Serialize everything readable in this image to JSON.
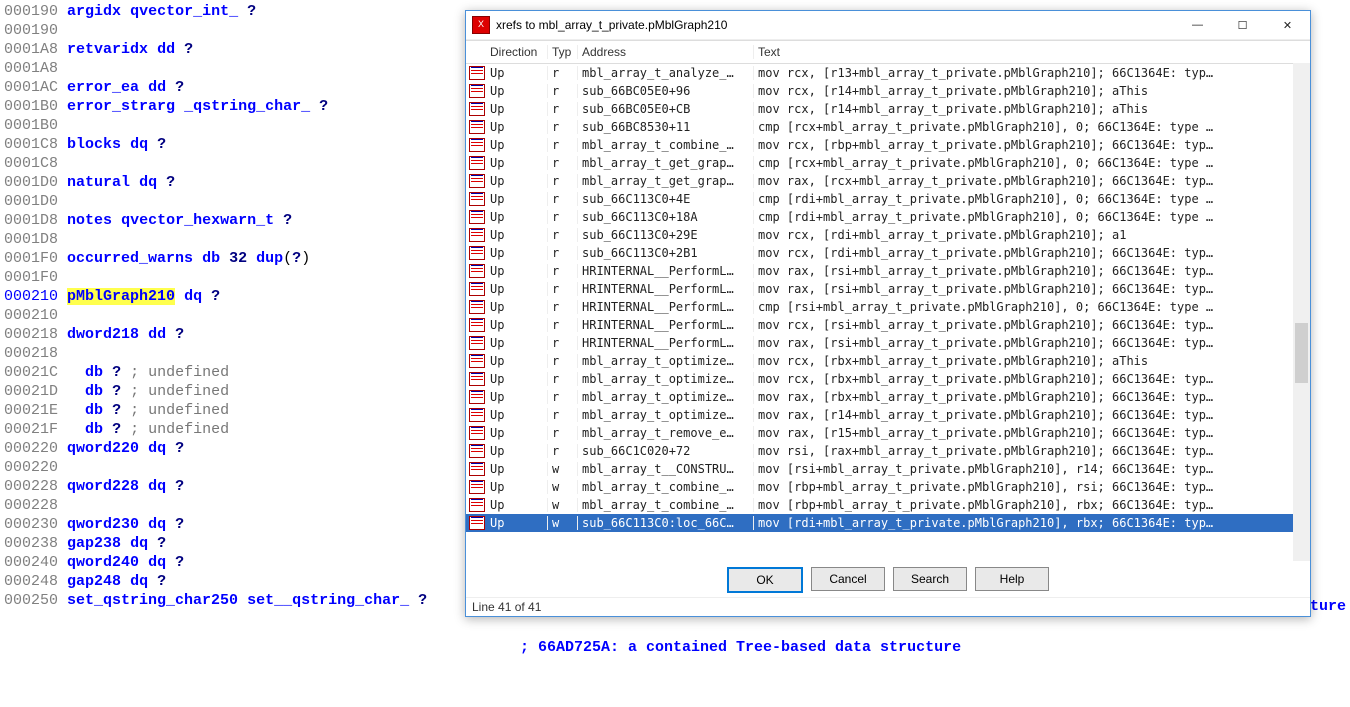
{
  "listing": [
    {
      "addr": "000190",
      "cls": "addr",
      "parts": [
        {
          "t": "argidx",
          "c": "name"
        },
        {
          "t": " "
        },
        {
          "t": "qvector_int_",
          "c": "kw"
        },
        {
          "t": " "
        },
        {
          "t": "?",
          "c": "val"
        }
      ]
    },
    {
      "addr": "000190",
      "cls": "addr"
    },
    {
      "addr": "0001A8",
      "cls": "addr",
      "parts": [
        {
          "t": "retvaridx",
          "c": "name"
        },
        {
          "t": " "
        },
        {
          "t": "dd",
          "c": "kw"
        },
        {
          "t": " "
        },
        {
          "t": "?",
          "c": "val"
        }
      ]
    },
    {
      "addr": "0001A8",
      "cls": "addr"
    },
    {
      "addr": "0001AC",
      "cls": "addr",
      "parts": [
        {
          "t": "error_ea",
          "c": "name"
        },
        {
          "t": " "
        },
        {
          "t": "dd",
          "c": "kw"
        },
        {
          "t": " "
        },
        {
          "t": "?",
          "c": "val"
        }
      ]
    },
    {
      "addr": "0001B0",
      "cls": "addr",
      "parts": [
        {
          "t": "error_strarg",
          "c": "name"
        },
        {
          "t": " "
        },
        {
          "t": "_qstring_char_",
          "c": "kw"
        },
        {
          "t": " "
        },
        {
          "t": "?",
          "c": "val"
        }
      ]
    },
    {
      "addr": "0001B0",
      "cls": "addr"
    },
    {
      "addr": "0001C8",
      "cls": "addr",
      "parts": [
        {
          "t": "blocks",
          "c": "name"
        },
        {
          "t": " "
        },
        {
          "t": "dq",
          "c": "kw"
        },
        {
          "t": " "
        },
        {
          "t": "?",
          "c": "val"
        }
      ]
    },
    {
      "addr": "0001C8",
      "cls": "addr"
    },
    {
      "addr": "0001D0",
      "cls": "addr",
      "parts": [
        {
          "t": "natural",
          "c": "name"
        },
        {
          "t": " "
        },
        {
          "t": "dq",
          "c": "kw"
        },
        {
          "t": " "
        },
        {
          "t": "?",
          "c": "val"
        }
      ]
    },
    {
      "addr": "0001D0",
      "cls": "addr"
    },
    {
      "addr": "0001D8",
      "cls": "addr",
      "parts": [
        {
          "t": "notes",
          "c": "name"
        },
        {
          "t": " "
        },
        {
          "t": "qvector_hexwarn_t",
          "c": "kw"
        },
        {
          "t": " "
        },
        {
          "t": "?",
          "c": "val"
        }
      ]
    },
    {
      "addr": "0001D8",
      "cls": "addr"
    },
    {
      "addr": "0001F0",
      "cls": "addr",
      "parts": [
        {
          "t": "occurred_warns",
          "c": "name"
        },
        {
          "t": " "
        },
        {
          "t": "db",
          "c": "kw"
        },
        {
          "t": " "
        },
        {
          "t": "32",
          "c": "val"
        },
        {
          "t": " "
        },
        {
          "t": "dup",
          "c": "kw"
        },
        {
          "t": "("
        },
        {
          "t": "?",
          "c": "val"
        },
        {
          "t": ")"
        }
      ]
    },
    {
      "addr": "0001F0",
      "cls": "addr"
    },
    {
      "addr": "000210",
      "cls": "addr-blue",
      "parts": [
        {
          "t": "pMblGraph210",
          "c": "name highlight"
        },
        {
          "t": " "
        },
        {
          "t": "dq",
          "c": "kw"
        },
        {
          "t": " "
        },
        {
          "t": "?",
          "c": "val"
        }
      ]
    },
    {
      "addr": "000210",
      "cls": "addr"
    },
    {
      "addr": "000218",
      "cls": "addr",
      "parts": [
        {
          "t": "dword218",
          "c": "name"
        },
        {
          "t": " "
        },
        {
          "t": "dd",
          "c": "kw"
        },
        {
          "t": " "
        },
        {
          "t": "?",
          "c": "val"
        }
      ]
    },
    {
      "addr": "000218",
      "cls": "addr"
    },
    {
      "addr": "00021C",
      "cls": "addr",
      "indent": 2,
      "parts": [
        {
          "t": "db",
          "c": "kw"
        },
        {
          "t": " "
        },
        {
          "t": "?",
          "c": "val"
        },
        {
          "t": " ; undefined",
          "c": "comment"
        }
      ]
    },
    {
      "addr": "00021D",
      "cls": "addr",
      "indent": 2,
      "parts": [
        {
          "t": "db",
          "c": "kw"
        },
        {
          "t": " "
        },
        {
          "t": "?",
          "c": "val"
        },
        {
          "t": " ; undefined",
          "c": "comment"
        }
      ]
    },
    {
      "addr": "00021E",
      "cls": "addr",
      "indent": 2,
      "parts": [
        {
          "t": "db",
          "c": "kw"
        },
        {
          "t": " "
        },
        {
          "t": "?",
          "c": "val"
        },
        {
          "t": " ; undefined",
          "c": "comment"
        }
      ]
    },
    {
      "addr": "00021F",
      "cls": "addr",
      "indent": 2,
      "parts": [
        {
          "t": "db",
          "c": "kw"
        },
        {
          "t": " "
        },
        {
          "t": "?",
          "c": "val"
        },
        {
          "t": " ; undefined",
          "c": "comment"
        }
      ]
    },
    {
      "addr": "000220",
      "cls": "addr",
      "parts": [
        {
          "t": "qword220",
          "c": "name"
        },
        {
          "t": " "
        },
        {
          "t": "dq",
          "c": "kw"
        },
        {
          "t": " "
        },
        {
          "t": "?",
          "c": "val"
        }
      ]
    },
    {
      "addr": "000220",
      "cls": "addr"
    },
    {
      "addr": "000228",
      "cls": "addr",
      "parts": [
        {
          "t": "qword228",
          "c": "name"
        },
        {
          "t": " "
        },
        {
          "t": "dq",
          "c": "kw"
        },
        {
          "t": " "
        },
        {
          "t": "?",
          "c": "val"
        }
      ]
    },
    {
      "addr": "000228",
      "cls": "addr"
    },
    {
      "addr": "000230",
      "cls": "addr",
      "parts": [
        {
          "t": "qword230",
          "c": "name"
        },
        {
          "t": " "
        },
        {
          "t": "dq",
          "c": "kw"
        },
        {
          "t": " "
        },
        {
          "t": "?",
          "c": "val"
        }
      ]
    },
    {
      "addr": "000238",
      "cls": "addr",
      "parts": [
        {
          "t": "gap238",
          "c": "name"
        },
        {
          "t": " "
        },
        {
          "t": "dq",
          "c": "kw"
        },
        {
          "t": " "
        },
        {
          "t": "?",
          "c": "val"
        }
      ]
    },
    {
      "addr": "000240",
      "cls": "addr",
      "parts": [
        {
          "t": "qword240",
          "c": "name"
        },
        {
          "t": " "
        },
        {
          "t": "dq",
          "c": "kw"
        },
        {
          "t": " "
        },
        {
          "t": "?",
          "c": "val"
        }
      ]
    },
    {
      "addr": "000248",
      "cls": "addr",
      "parts": [
        {
          "t": "gap248",
          "c": "name"
        },
        {
          "t": " "
        },
        {
          "t": "dq",
          "c": "kw"
        },
        {
          "t": " "
        },
        {
          "t": "?",
          "c": "val"
        }
      ]
    },
    {
      "addr": "000250",
      "cls": "addr",
      "parts": [
        {
          "t": "set_qstring_char250",
          "c": "name"
        },
        {
          "t": " "
        },
        {
          "t": "set__qstring_char_",
          "c": "kw"
        },
        {
          "t": " "
        },
        {
          "t": "?",
          "c": "val"
        }
      ]
    }
  ],
  "far_comment_1": "ture",
  "far_comment_2": "; 66AD725A: a contained Tree-based data structure",
  "modal": {
    "title": "xrefs to mbl_array_t_private.pMblGraph210",
    "headers": {
      "dir": "Direction",
      "typ": "Typ",
      "addr": "Address",
      "text": "Text"
    },
    "rows": [
      {
        "dir": "Up",
        "typ": "r",
        "addr": "mbl_array_t_analyze_…",
        "text": "mov     rcx, [r13+mbl_array_t_private.pMblGraph210]; 66C1364E: typ…"
      },
      {
        "dir": "Up",
        "typ": "r",
        "addr": "sub_66BC05E0+96",
        "text": "mov     rcx, [r14+mbl_array_t_private.pMblGraph210]; aThis"
      },
      {
        "dir": "Up",
        "typ": "r",
        "addr": "sub_66BC05E0+CB",
        "text": "mov     rcx, [r14+mbl_array_t_private.pMblGraph210]; aThis"
      },
      {
        "dir": "Up",
        "typ": "r",
        "addr": "sub_66BC8530+11",
        "text": "cmp     [rcx+mbl_array_t_private.pMblGraph210], 0; 66C1364E: type …"
      },
      {
        "dir": "Up",
        "typ": "r",
        "addr": "mbl_array_t_combine_…",
        "text": "mov     rcx, [rbp+mbl_array_t_private.pMblGraph210]; 66C1364E: typ…"
      },
      {
        "dir": "Up",
        "typ": "r",
        "addr": "mbl_array_t_get_grap…",
        "text": "cmp     [rcx+mbl_array_t_private.pMblGraph210], 0; 66C1364E: type …"
      },
      {
        "dir": "Up",
        "typ": "r",
        "addr": "mbl_array_t_get_grap…",
        "text": "mov     rax, [rcx+mbl_array_t_private.pMblGraph210]; 66C1364E: typ…"
      },
      {
        "dir": "Up",
        "typ": "r",
        "addr": "sub_66C113C0+4E",
        "text": "cmp     [rdi+mbl_array_t_private.pMblGraph210], 0; 66C1364E: type …"
      },
      {
        "dir": "Up",
        "typ": "r",
        "addr": "sub_66C113C0+18A",
        "text": "cmp     [rdi+mbl_array_t_private.pMblGraph210], 0; 66C1364E: type …"
      },
      {
        "dir": "Up",
        "typ": "r",
        "addr": "sub_66C113C0+29E",
        "text": "mov     rcx, [rdi+mbl_array_t_private.pMblGraph210]; a1"
      },
      {
        "dir": "Up",
        "typ": "r",
        "addr": "sub_66C113C0+2B1",
        "text": "mov     rcx, [rdi+mbl_array_t_private.pMblGraph210]; 66C1364E: typ…"
      },
      {
        "dir": "Up",
        "typ": "r",
        "addr": "HRINTERNAL__PerformL…",
        "text": "mov     rax, [rsi+mbl_array_t_private.pMblGraph210]; 66C1364E: typ…"
      },
      {
        "dir": "Up",
        "typ": "r",
        "addr": "HRINTERNAL__PerformL…",
        "text": "mov     rax, [rsi+mbl_array_t_private.pMblGraph210]; 66C1364E: typ…"
      },
      {
        "dir": "Up",
        "typ": "r",
        "addr": "HRINTERNAL__PerformL…",
        "text": "cmp     [rsi+mbl_array_t_private.pMblGraph210], 0; 66C1364E: type …"
      },
      {
        "dir": "Up",
        "typ": "r",
        "addr": "HRINTERNAL__PerformL…",
        "text": "mov     rcx, [rsi+mbl_array_t_private.pMblGraph210]; 66C1364E: typ…"
      },
      {
        "dir": "Up",
        "typ": "r",
        "addr": "HRINTERNAL__PerformL…",
        "text": "mov     rax, [rsi+mbl_array_t_private.pMblGraph210]; 66C1364E: typ…"
      },
      {
        "dir": "Up",
        "typ": "r",
        "addr": "mbl_array_t_optimize…",
        "text": "mov     rcx, [rbx+mbl_array_t_private.pMblGraph210]; aThis"
      },
      {
        "dir": "Up",
        "typ": "r",
        "addr": "mbl_array_t_optimize…",
        "text": "mov     rcx, [rbx+mbl_array_t_private.pMblGraph210]; 66C1364E: typ…"
      },
      {
        "dir": "Up",
        "typ": "r",
        "addr": "mbl_array_t_optimize…",
        "text": "mov     rax, [rbx+mbl_array_t_private.pMblGraph210]; 66C1364E: typ…"
      },
      {
        "dir": "Up",
        "typ": "r",
        "addr": "mbl_array_t_optimize…",
        "text": "mov     rax, [r14+mbl_array_t_private.pMblGraph210]; 66C1364E: typ…"
      },
      {
        "dir": "Up",
        "typ": "r",
        "addr": "mbl_array_t_remove_e…",
        "text": "mov     rax, [r15+mbl_array_t_private.pMblGraph210]; 66C1364E: typ…"
      },
      {
        "dir": "Up",
        "typ": "r",
        "addr": "sub_66C1C020+72",
        "text": "mov     rsi, [rax+mbl_array_t_private.pMblGraph210]; 66C1364E: typ…"
      },
      {
        "dir": "Up",
        "typ": "w",
        "addr": "mbl_array_t__CONSTRU…",
        "text": "mov     [rsi+mbl_array_t_private.pMblGraph210], r14; 66C1364E: typ…"
      },
      {
        "dir": "Up",
        "typ": "w",
        "addr": "mbl_array_t_combine_…",
        "text": "mov     [rbp+mbl_array_t_private.pMblGraph210], rsi; 66C1364E: typ…"
      },
      {
        "dir": "Up",
        "typ": "w",
        "addr": "mbl_array_t_combine_…",
        "text": "mov     [rbp+mbl_array_t_private.pMblGraph210], rbx; 66C1364E: typ…"
      },
      {
        "dir": "Up",
        "typ": "w",
        "addr": "sub_66C113C0:loc_66C…",
        "text": "mov     [rdi+mbl_array_t_private.pMblGraph210], rbx; 66C1364E: typ…",
        "sel": true
      }
    ],
    "buttons": {
      "ok": "OK",
      "cancel": "Cancel",
      "search": "Search",
      "help": "Help"
    },
    "status": "Line 41 of 41"
  }
}
